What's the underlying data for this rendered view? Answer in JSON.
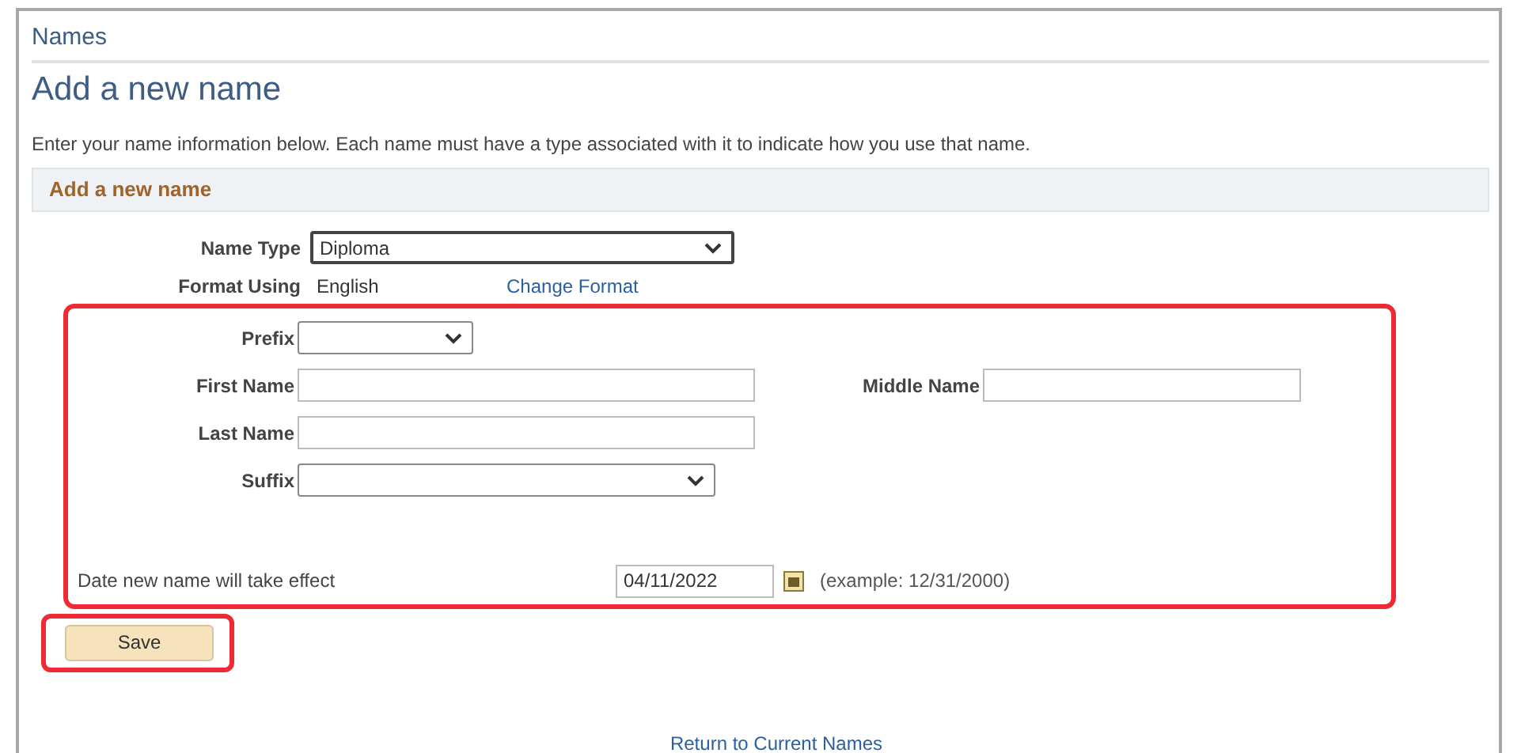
{
  "breadcrumb": "Names",
  "title": "Add a new name",
  "intro": "Enter your name information below. Each name must have a type associated with it to indicate how you use that name.",
  "section_title": "Add a new name",
  "name_type": {
    "label": "Name Type",
    "value": "Diploma"
  },
  "format": {
    "label": "Format Using",
    "value": "English",
    "link": "Change Format"
  },
  "name_fields": {
    "highlighted": true,
    "rows": [
      [
        {
          "kind": "select",
          "label": "Prefix"
        }
      ],
      [
        {
          "kind": "text",
          "label": "First Name"
        },
        {
          "kind": "text",
          "label": "Middle Name"
        }
      ],
      [
        {
          "kind": "text",
          "label": "Last Name"
        }
      ],
      [
        {
          "kind": "select",
          "label": "Suffix"
        }
      ]
    ],
    "effective_date": {
      "label": "Date new name will take effect",
      "value": "04/11/2022",
      "hint": "(example: 12/31/2000)"
    }
  },
  "save_button": {
    "label": "Save",
    "highlighted": true
  },
  "return_link": "Return to Current Names"
}
